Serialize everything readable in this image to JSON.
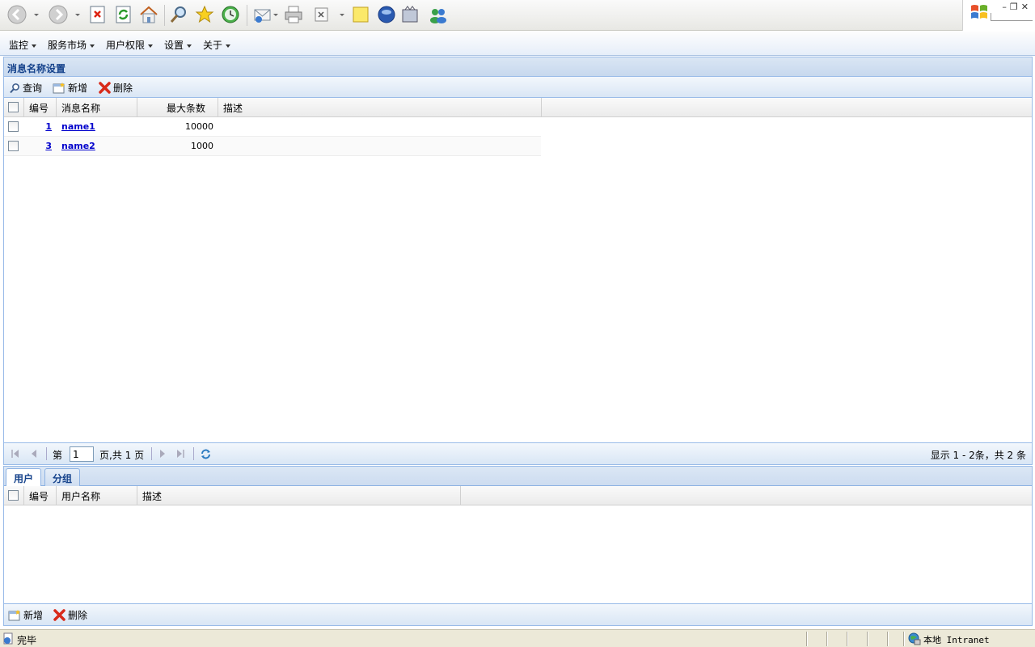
{
  "menu": {
    "items": [
      {
        "label": "监控"
      },
      {
        "label": "服务市场"
      },
      {
        "label": "用户权限"
      },
      {
        "label": "设置"
      },
      {
        "label": "关于"
      }
    ]
  },
  "main_panel": {
    "title": "消息名称设置",
    "toolbar": {
      "query_label": "查询",
      "add_label": "新增",
      "delete_label": "删除"
    },
    "columns": [
      "编号",
      "消息名称",
      "最大条数",
      "描述"
    ],
    "rows": [
      {
        "id": "1",
        "name": "name1",
        "max": "10000",
        "desc": ""
      },
      {
        "id": "3",
        "name": "name2",
        "max": "1000",
        "desc": ""
      }
    ],
    "pager": {
      "page_prefix": "第",
      "page_value": "1",
      "page_suffix": "页,共 1 页",
      "display_info": "显示 1 - 2条，共 2 条"
    }
  },
  "sub_panel": {
    "tabs": [
      {
        "label": "用户",
        "active": true
      },
      {
        "label": "分组",
        "active": false
      }
    ],
    "columns": [
      "编号",
      "用户名称",
      "描述"
    ],
    "toolbar": {
      "add_label": "新增",
      "delete_label": "删除"
    }
  },
  "statusbar": {
    "status_text": "完毕",
    "zone_text": "本地 Intranet"
  },
  "colors": {
    "panel_header_text": "#15428b",
    "panel_border": "#99bbe8",
    "link": "#0000cc"
  }
}
